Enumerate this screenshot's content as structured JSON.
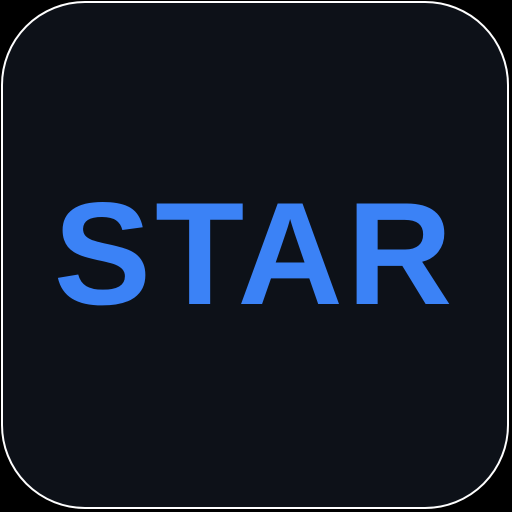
{
  "app_icon": {
    "label": "STAR",
    "text_color": "#3b82f6",
    "background_color": "#0d1118",
    "border_color": "#ffffff"
  }
}
